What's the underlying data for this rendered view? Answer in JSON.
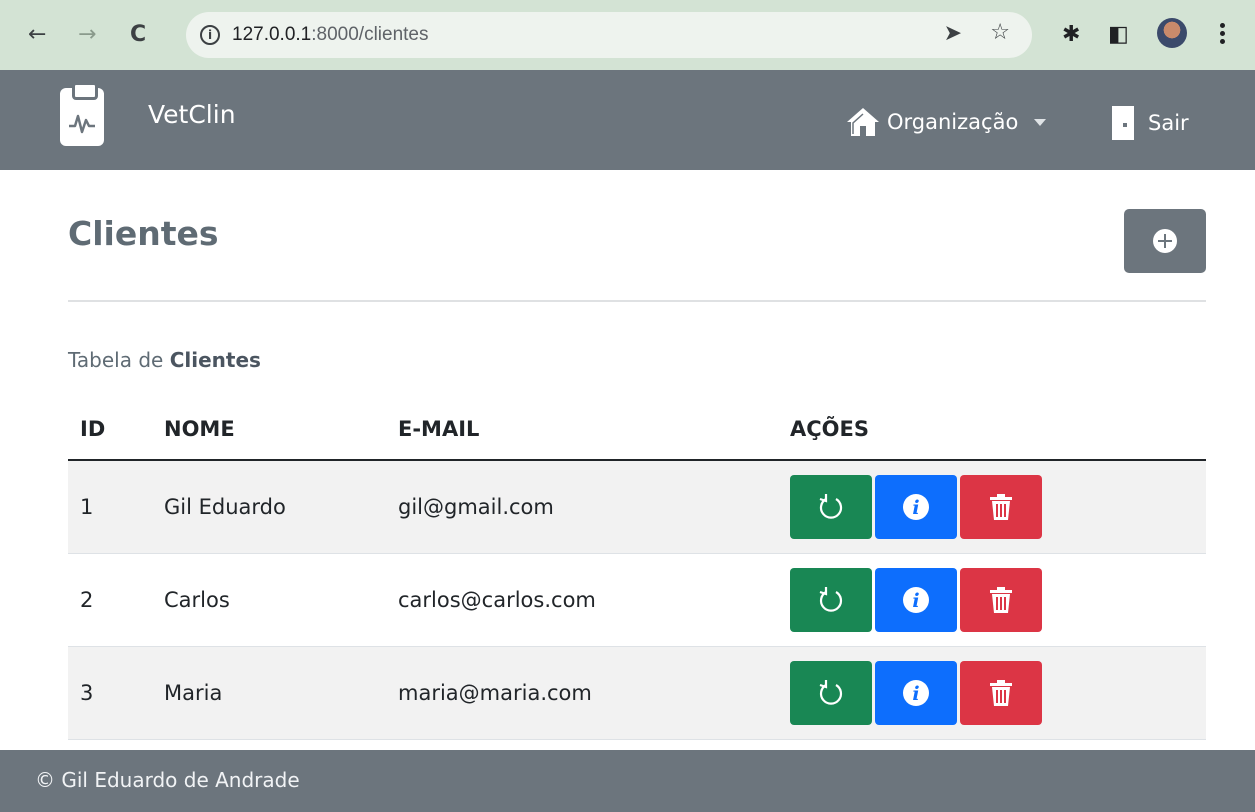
{
  "browser": {
    "url_host": "127.0.0.1",
    "url_rest": ":8000/clientes"
  },
  "app": {
    "brand": "VetClin",
    "org_menu_label": "Organização",
    "logout_label": "Sair"
  },
  "page": {
    "title": "Clientes",
    "caption_prefix": "Tabela de ",
    "caption_bold": "Clientes"
  },
  "table": {
    "columns": [
      "ID",
      "NOME",
      "E-MAIL",
      "AÇÕES"
    ],
    "rows": [
      {
        "id": "1",
        "nome": "Gil Eduardo",
        "email": "gil@gmail.com"
      },
      {
        "id": "2",
        "nome": "Carlos",
        "email": "carlos@carlos.com"
      },
      {
        "id": "3",
        "nome": "Maria",
        "email": "maria@maria.com"
      }
    ],
    "actions": [
      "refresh-icon",
      "info-icon",
      "trash-icon"
    ]
  },
  "footer": {
    "text": "© Gil Eduardo de Andrade"
  },
  "colors": {
    "navbar": "#6c757d",
    "refresh": "#198754",
    "info": "#0d6efd",
    "delete": "#dc3545"
  }
}
